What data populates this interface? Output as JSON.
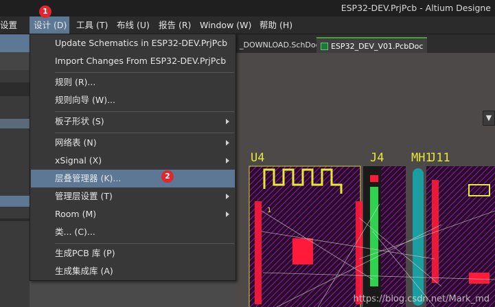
{
  "window": {
    "title": "ESP32-DEV.PrjPcb - Altium Designe"
  },
  "menubar": {
    "items": [
      {
        "label": "设置"
      },
      {
        "label": "设计 (D)"
      },
      {
        "label": "工具 (T)"
      },
      {
        "label": "布线 (U)"
      },
      {
        "label": "报告 (R)"
      },
      {
        "label": "Window (W)"
      },
      {
        "label": "帮助 (H)"
      }
    ],
    "badge": "1"
  },
  "tabs": [
    {
      "label": "_DOWNLOAD.SchDoc"
    },
    {
      "label": "ESP32_DEV_V01.PcbDoc"
    }
  ],
  "design_menu": {
    "items": [
      {
        "label": "Update Schematics in ESP32-DEV.PrjPcb",
        "submenu": false
      },
      {
        "label": "Import Changes From ESP32-DEV.PrjPcb",
        "submenu": false
      },
      {
        "label": "规则 (R)...",
        "submenu": false
      },
      {
        "label": "规则向导 (W)...",
        "submenu": false
      },
      {
        "label": "板子形状 (S)",
        "submenu": true
      },
      {
        "label": "网络表 (N)",
        "submenu": true
      },
      {
        "label": "xSignal (X)",
        "submenu": true
      },
      {
        "label": "层叠管理器 (K)...",
        "submenu": false
      },
      {
        "label": "管理层设置 (T)",
        "submenu": true
      },
      {
        "label": "Room (M)",
        "submenu": true
      },
      {
        "label": "类... (C)...",
        "submenu": false
      },
      {
        "label": "生成PCB 库 (P)",
        "submenu": false
      },
      {
        "label": "生成集成库 (A)",
        "submenu": false
      }
    ],
    "highlighted_badge": "2"
  },
  "pcb": {
    "designators": [
      "U4",
      "J4",
      "MH1",
      "J11"
    ],
    "colors": {
      "board": "#2a0a2a",
      "pad": "#ff1a3a",
      "silk": "#e8e83a",
      "green": "#2fd24f",
      "teal": "#1a9ea0"
    }
  },
  "watermark": "https://blog.csdn.net/Mark_md"
}
